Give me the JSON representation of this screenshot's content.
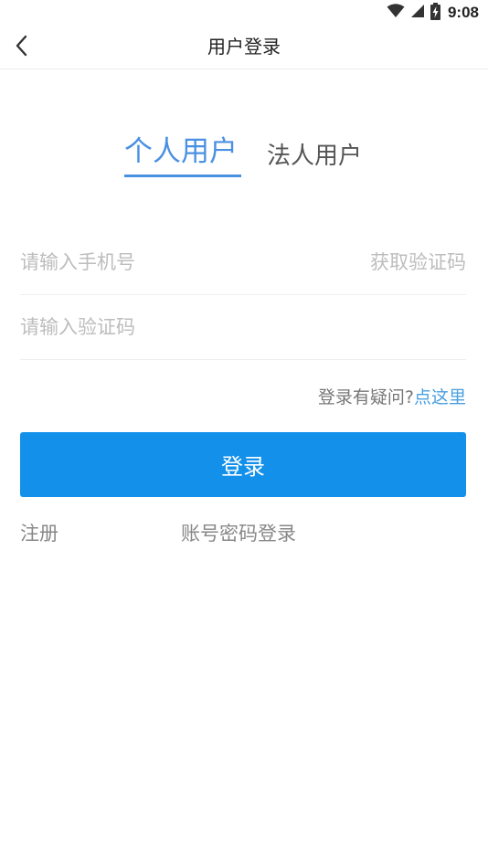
{
  "status_bar": {
    "time": "9:08",
    "icons": [
      "wifi-icon",
      "cellular-signal-icon",
      "battery-charging-icon"
    ]
  },
  "header": {
    "title": "用户登录",
    "back_icon": "chevron-left-icon"
  },
  "tabs": {
    "personal": "个人用户",
    "legal": "法人用户",
    "active": "personal"
  },
  "form": {
    "phone_placeholder": "请输入手机号",
    "phone_value": "",
    "get_code_label": "获取验证码",
    "code_placeholder": "请输入验证码",
    "code_value": ""
  },
  "help": {
    "text": "登录有疑问?",
    "link": "点这里"
  },
  "login_button": "登录",
  "bottom_links": {
    "register": "注册",
    "password_login": "账号密码登录"
  },
  "colors": {
    "accent": "#1390ea",
    "tab_active": "#4a90e2",
    "link": "#4a9fe0",
    "placeholder": "#bdbdbd"
  }
}
